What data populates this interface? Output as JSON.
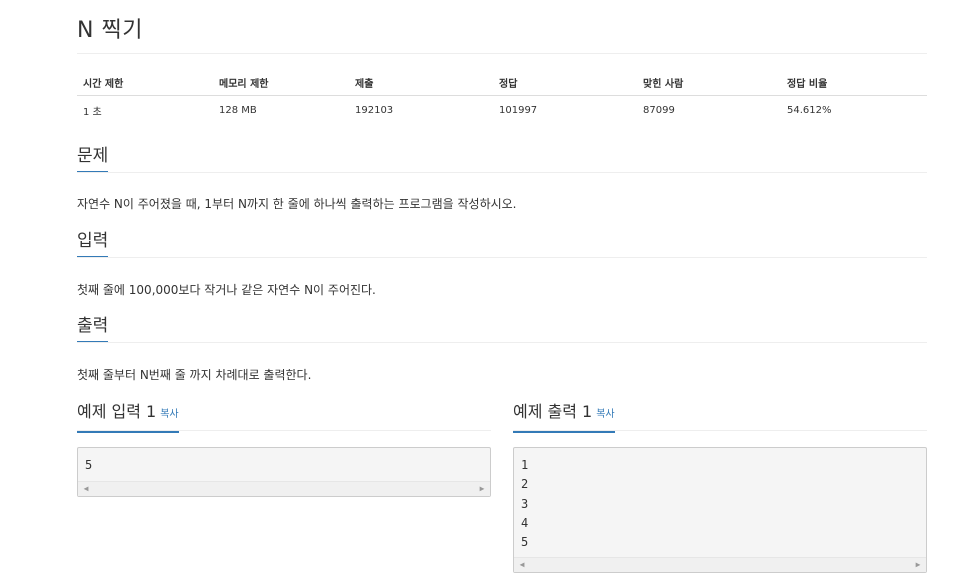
{
  "problem": {
    "title": "N 찍기"
  },
  "info_table": {
    "headers": [
      "시간 제한",
      "메모리 제한",
      "제출",
      "정답",
      "맞힌 사람",
      "정답 비율"
    ],
    "values": [
      "1 초",
      "128 MB",
      "192103",
      "101997",
      "87099",
      "54.612%"
    ]
  },
  "sections": {
    "problem": {
      "heading": "문제",
      "text": "자연수 N이 주어졌을 때, 1부터 N까지 한 줄에 하나씩 출력하는 프로그램을 작성하시오."
    },
    "input": {
      "heading": "입력",
      "text": "첫째 줄에 100,000보다 작거나 같은 자연수 N이 주어진다."
    },
    "output": {
      "heading": "출력",
      "text": "첫째 줄부터 N번째 줄 까지 차례대로 출력한다."
    }
  },
  "samples": {
    "input": {
      "heading": "예제 입력 1",
      "copy_label": "복사",
      "lines": [
        "5"
      ]
    },
    "output": {
      "heading": "예제 출력 1",
      "copy_label": "복사",
      "lines": [
        "1",
        "2",
        "3",
        "4",
        "5"
      ]
    }
  },
  "icons": {
    "scroll_left": "chevron-left-icon",
    "scroll_right": "chevron-right-icon"
  },
  "colors": {
    "accent": "#337ab7",
    "pre_background": "#f5f5f5"
  }
}
